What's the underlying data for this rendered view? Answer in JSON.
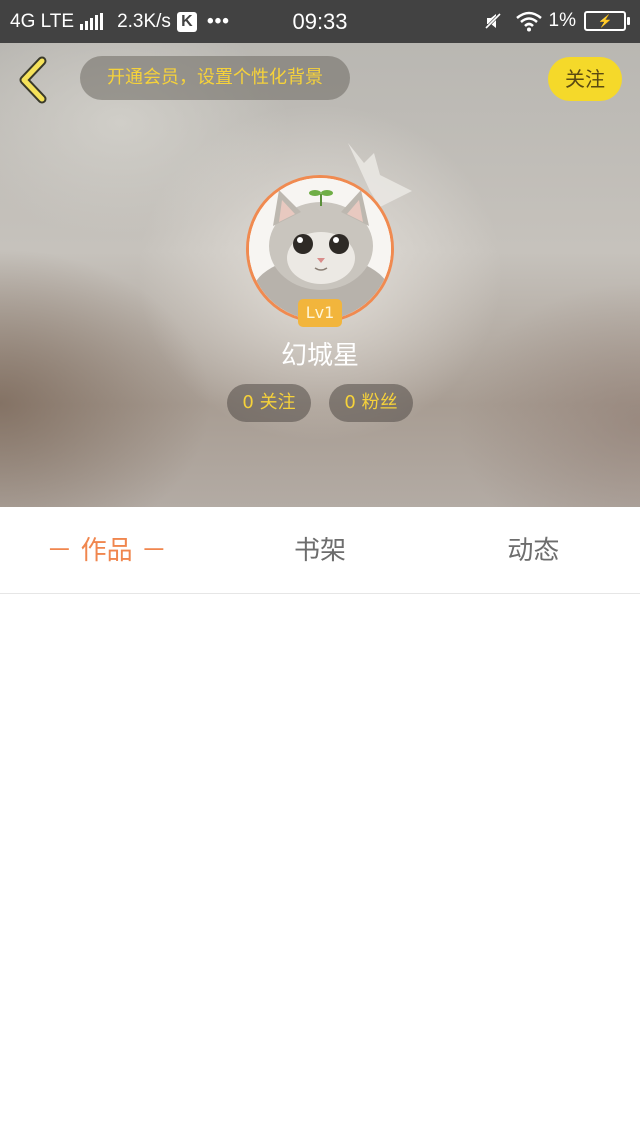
{
  "status_bar": {
    "network": "4G LTE",
    "speed": "2.3K/s",
    "k_icon": "K",
    "dots": "•••",
    "time": "09:33",
    "battery": "1%"
  },
  "header": {
    "vip_banner": "开通会员，设置个性化背景",
    "follow_button": "关注"
  },
  "profile": {
    "level": "Lv1",
    "username": "幻城星",
    "following": "0 关注",
    "followers": "0 粉丝"
  },
  "tabs": [
    {
      "label": "－ 作品 －",
      "active": true
    },
    {
      "label": "书架",
      "active": false
    },
    {
      "label": "动态",
      "active": false
    }
  ],
  "colors": {
    "accent": "#f0864e",
    "yellow": "#f5d92a",
    "status_bar": "#424242"
  },
  "icons": {
    "back": "chevron-left-icon",
    "crown": "crown-icon",
    "wifi": "wifi-icon",
    "mute": "vibrate-off-icon"
  }
}
